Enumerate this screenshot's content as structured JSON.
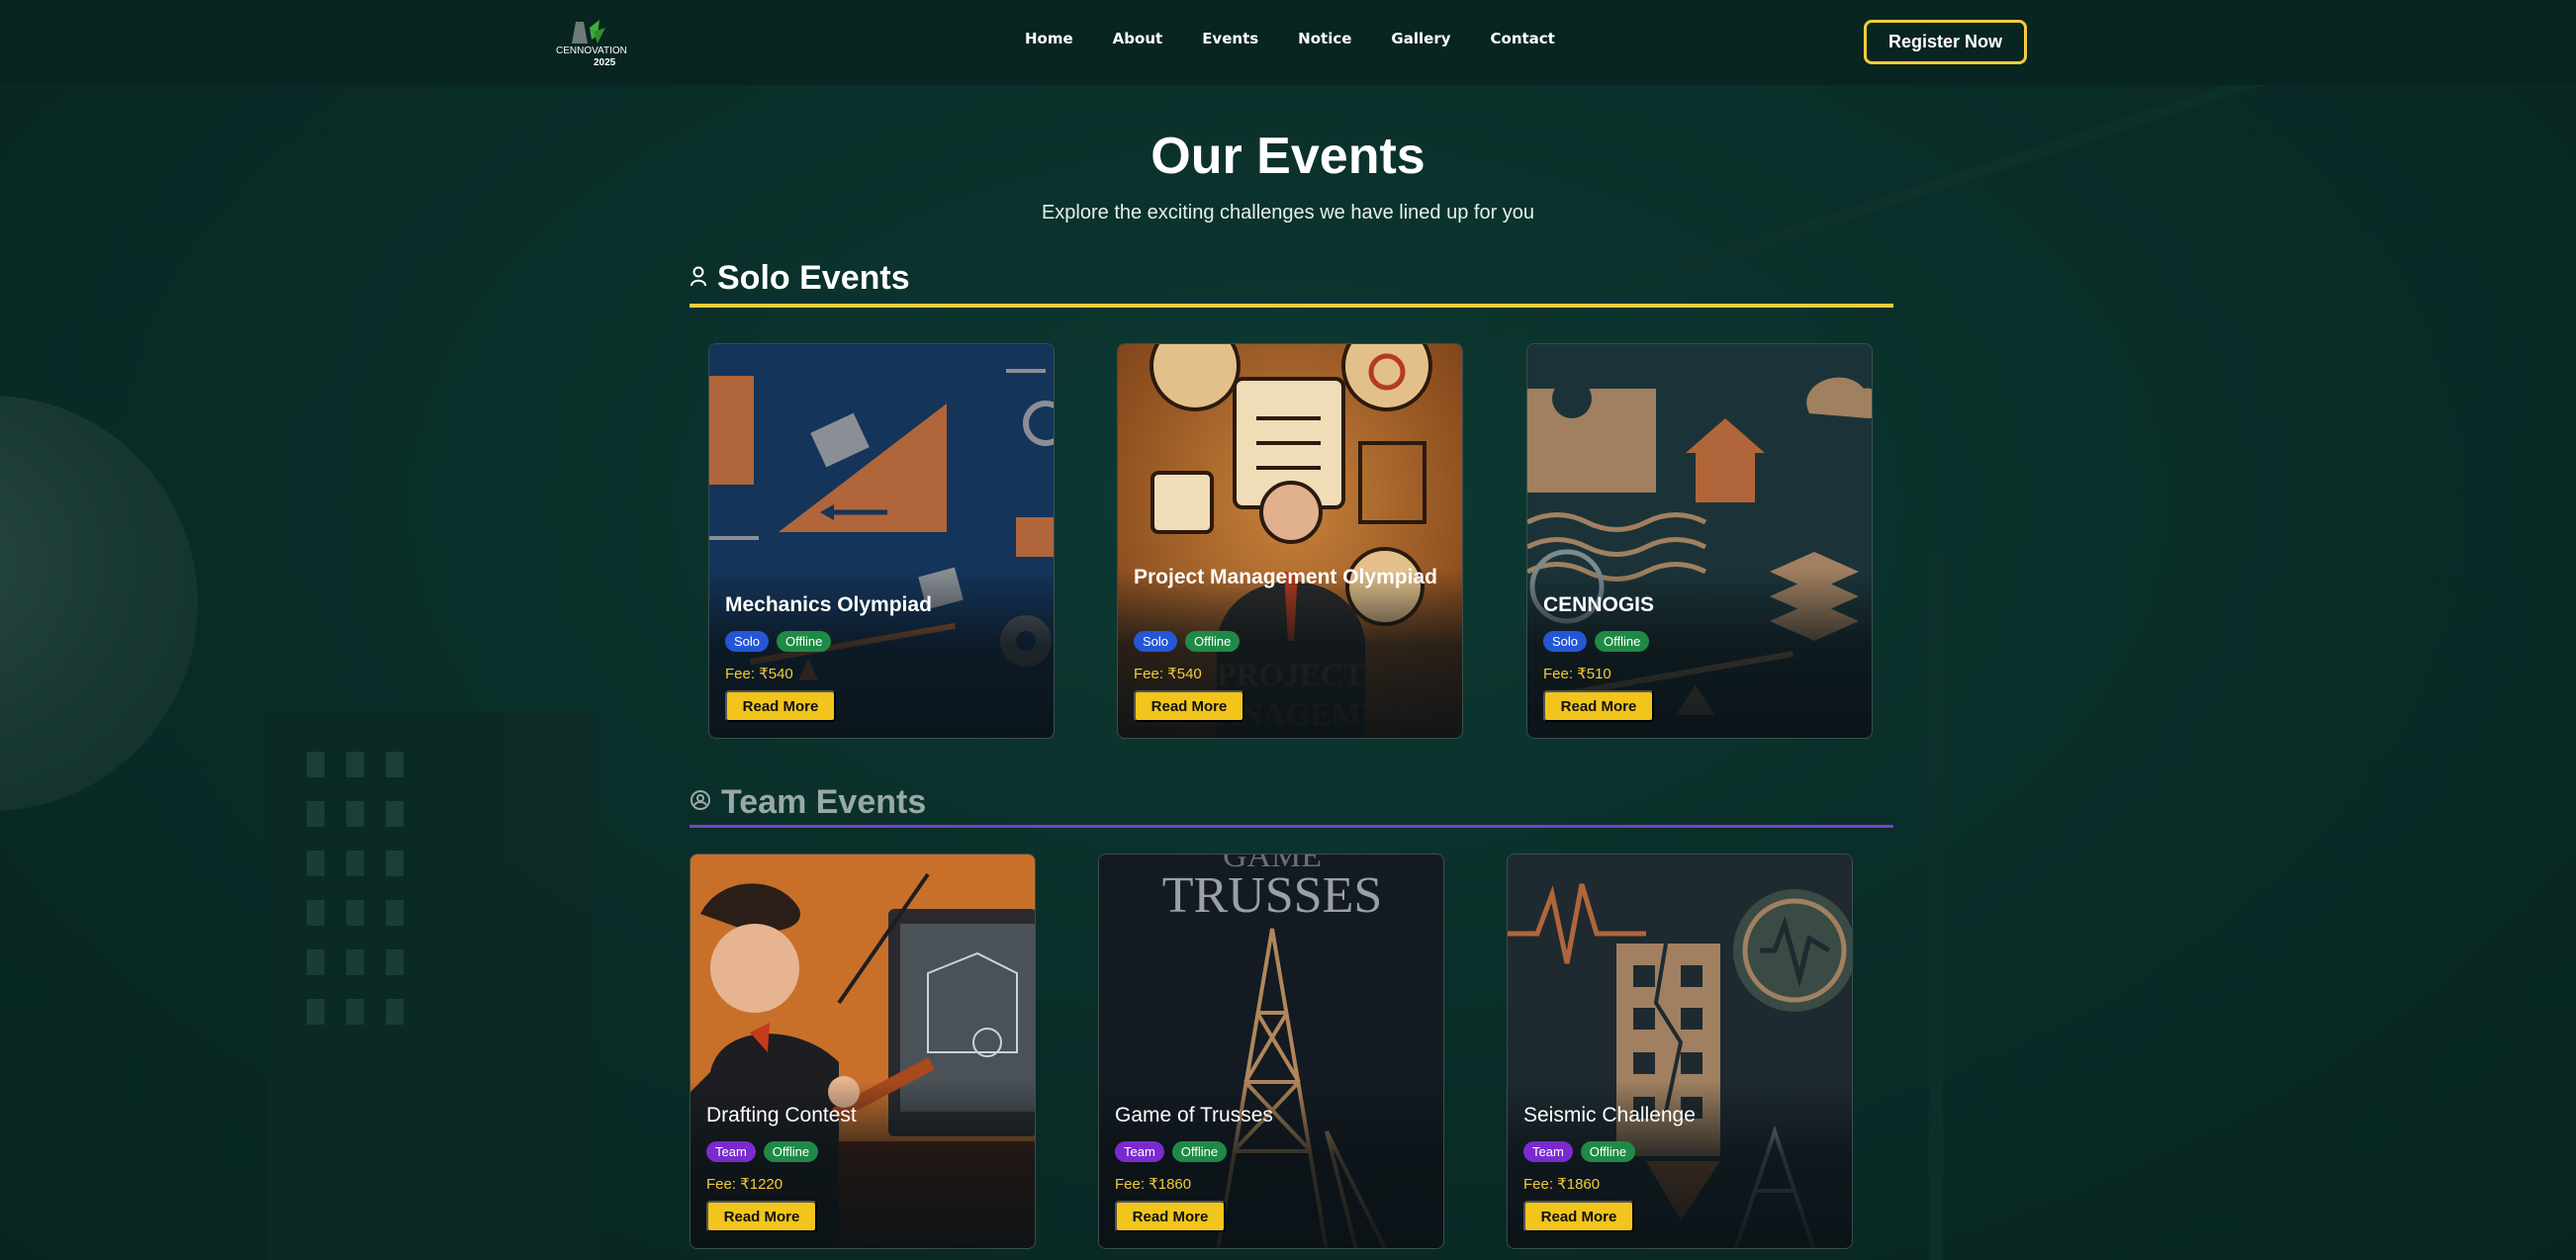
{
  "header": {
    "logo_text": "CENNOVATION 2025",
    "nav": [
      "Home",
      "About",
      "Events",
      "Notice",
      "Gallery",
      "Contact"
    ],
    "register_label": "Register Now"
  },
  "hero": {
    "title": "Our Events",
    "subtitle": "Explore the exciting challenges we have lined up for you"
  },
  "solo": {
    "heading": "Solo Events",
    "icon": "person-icon",
    "accent": "#f2cc3a",
    "cards": [
      {
        "name": "Mechanics Olympiad",
        "tag1": "Solo",
        "tag2": "Offline",
        "fee": "Fee: ₹540",
        "button": "Read More"
      },
      {
        "name": "Project Management Olympiad",
        "tag1": "Solo",
        "tag2": "Offline",
        "fee": "Fee: ₹540",
        "button": "Read More",
        "watermark": "PROJECT MANAGEMENT"
      },
      {
        "name": "CENNOGIS",
        "tag1": "Solo",
        "tag2": "Offline",
        "fee": "Fee: ₹510",
        "button": "Read More"
      }
    ]
  },
  "team": {
    "heading": "Team Events",
    "icon": "team-icon",
    "accent": "#7c3fc4",
    "cards": [
      {
        "name": "Drafting Contest",
        "tag1": "Team",
        "tag2": "Offline",
        "fee": "Fee: ₹1220",
        "button": "Read More"
      },
      {
        "name": "Game of Trusses",
        "tag1": "Team",
        "tag2": "Offline",
        "fee": "Fee: ₹1860",
        "button": "Read More",
        "watermark": "GAME TRUSSES"
      },
      {
        "name": "Seismic Challenge",
        "tag1": "Team",
        "tag2": "Offline",
        "fee": "Fee: ₹1860",
        "button": "Read More"
      }
    ]
  }
}
